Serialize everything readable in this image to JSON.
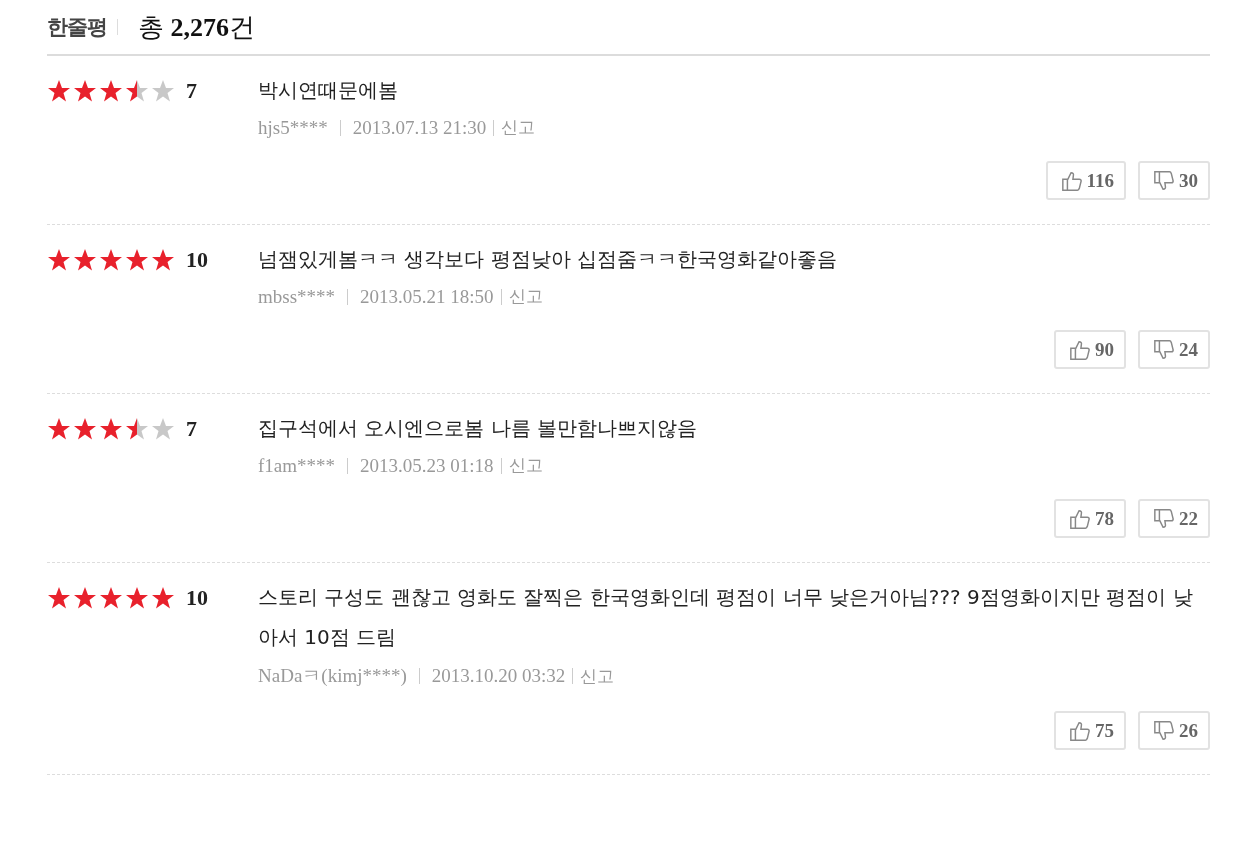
{
  "header": {
    "title": "한줄평",
    "total_label": "총",
    "total_count": "2,276",
    "total_unit": "건"
  },
  "reviews": [
    {
      "stars": 3.5,
      "score": "7",
      "text": "박시연때문에봄",
      "user": "hjs5****",
      "date": "2013.07.13 21:30",
      "report": "신고",
      "likes": "116",
      "dislikes": "30"
    },
    {
      "stars": 5,
      "score": "10",
      "text": "넘잼있게봄ㅋㅋ 생각보다 평점낮아 십점줌ㅋㅋ한국영화같아좋음",
      "user": "mbss****",
      "date": "2013.05.21 18:50",
      "report": "신고",
      "likes": "90",
      "dislikes": "24"
    },
    {
      "stars": 3.5,
      "score": "7",
      "text": "집구석에서 오시엔으로봄 나름 볼만함나쁘지않음",
      "user": "f1am****",
      "date": "2013.05.23 01:18",
      "report": "신고",
      "likes": "78",
      "dislikes": "22"
    },
    {
      "stars": 5,
      "score": "10",
      "text": "스토리 구성도 괜찮고 영화도 잘찍은 한국영화인데 평점이 너무 낮은거아님??? 9점영화이지만 평점이 낮아서 10점 드림",
      "user": "NaDaㅋ(kimj****)",
      "date": "2013.10.20 03:32",
      "report": "신고",
      "likes": "75",
      "dislikes": "26"
    }
  ]
}
